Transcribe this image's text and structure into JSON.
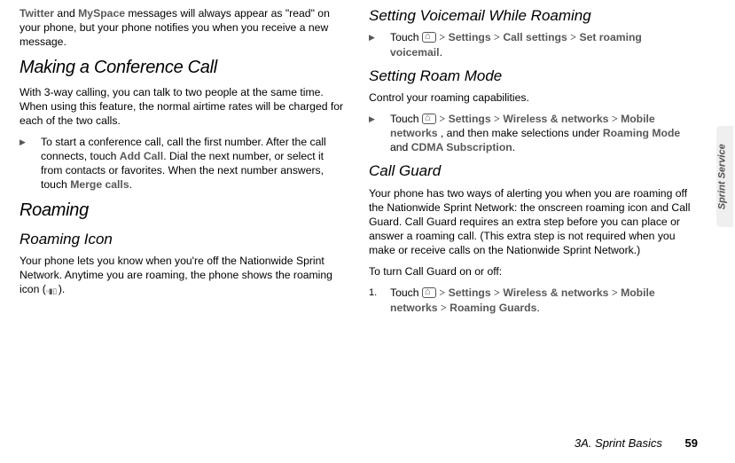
{
  "col1": {
    "intro": {
      "t1": "Twitter",
      "t2": " and ",
      "t3": "MySpace",
      "t4": " messages will always appear as \"read\" on your phone, but your phone notifies you when you receive a new message."
    },
    "h_conf": "Making a Conference Call",
    "p_conf": "With 3-way calling, you can talk to two people at the same time. When using this feature, the normal airtime rates will be charged for each of the two calls.",
    "step_conf": {
      "a": "To start a conference call, call the first number. After the call connects, touch ",
      "b": "Add Call",
      "c": ". Dial the next number, or select it from contacts or favorites. When the next number answers, touch ",
      "d": "Merge calls",
      "e": "."
    },
    "h_roam": "Roaming",
    "h_roam_icon": "Roaming Icon",
    "p_roam": "Your phone lets you know when you're off the Nationwide Sprint Network. Anytime you are roaming, the phone shows the roaming icon ("
  },
  "col2": {
    "h_vm": "Setting Voicemail While Roaming",
    "vm_step": {
      "a": "Touch ",
      "gt": ">",
      "s": "Settings",
      "cs": "Call settings",
      "srv": "Set roaming voicemail",
      "dot": "."
    },
    "h_rm": "Setting Roam Mode",
    "p_rm": "Control your roaming capabilities.",
    "rm_step": {
      "a": "Touch ",
      "s": "Settings",
      "wn": "Wireless & networks",
      "mn": "Mobile networks",
      "mid": " , and then make selections under ",
      "rmode": "Roaming Mode",
      "and": " and ",
      "cdma": "CDMA Subscription",
      "dot": "."
    },
    "h_cg": "Call Guard",
    "p_cg": "Your phone has two ways of alerting you when you are roaming off the Nationwide Sprint Network: the onscreen roaming icon and Call Guard. Call Guard requires an extra step before you can place or answer a roaming call. (This extra step is not required when you make or receive calls on the Nationwide Sprint Network.)",
    "p_onoff": "To turn Call Guard on or off:",
    "cg_step": {
      "num": "1.",
      "a": "Touch ",
      "s": "Settings",
      "wn": "Wireless & networks",
      "mn": "Mobile networks",
      "rg": "Roaming Guards",
      "dot": "."
    }
  },
  "sidetab": "Sprint Service",
  "footer_section": "3A. Sprint Basics",
  "footer_page": "59",
  "gt": ">"
}
